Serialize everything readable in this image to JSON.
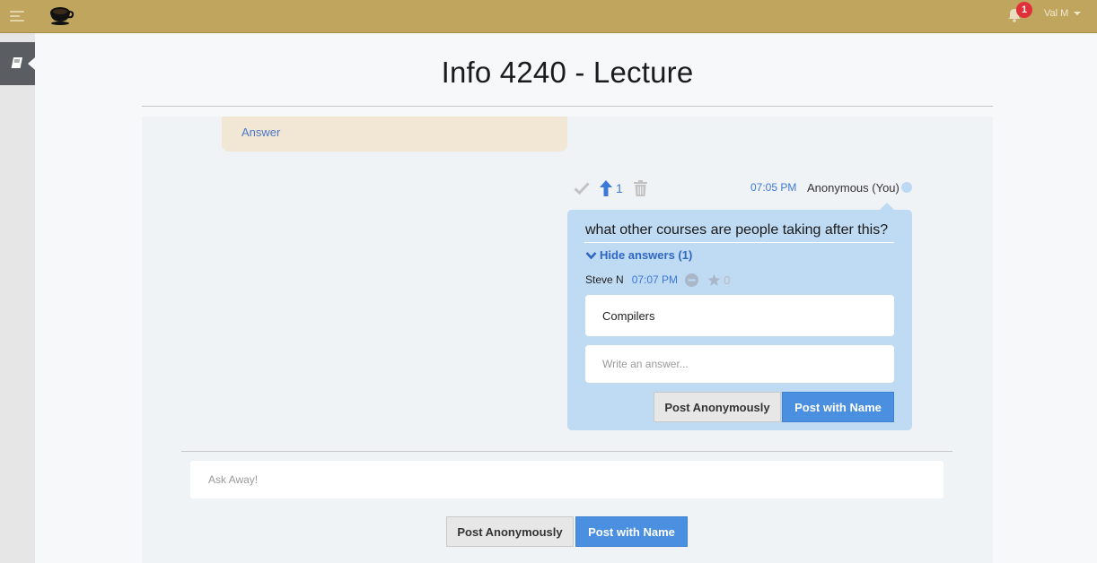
{
  "topbar": {
    "notification_count": "1",
    "user_name": "Val M"
  },
  "page": {
    "title": "Info 4240 - Lecture"
  },
  "previous_card": {
    "action_label": "Answer"
  },
  "question": {
    "upvote_count": "1",
    "time": "07:05 PM",
    "author": "Anonymous (You)",
    "text": "what other courses are people taking after this?",
    "toggle_label": "Hide answers (1)",
    "answers": [
      {
        "author": "Steve N",
        "time": "07:07 PM",
        "star_count": "0",
        "text": "Compilers"
      }
    ],
    "answer_placeholder": "Write an answer...",
    "post_anon_label": "Post Anonymously",
    "post_name_label": "Post with Name"
  },
  "composer": {
    "placeholder": "Ask Away!",
    "post_anon_label": "Post Anonymously",
    "post_name_label": "Post with Name"
  },
  "colors": {
    "topbar": "#bfa55e",
    "question_card": "#bfdaf3",
    "accent_blue": "#4a8fe0",
    "badge_red": "#e0313a"
  }
}
